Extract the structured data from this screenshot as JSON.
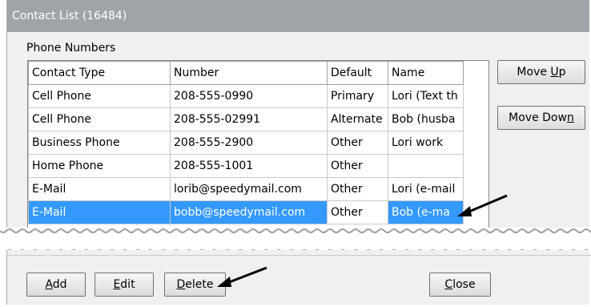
{
  "window": {
    "title": "Contact List (16484)"
  },
  "phone_numbers": {
    "group_label": "Phone Numbers",
    "columns": [
      "Contact Type",
      "Number",
      "Default",
      "Name"
    ],
    "rows": [
      [
        "Cell Phone",
        "208-555-0990",
        "Primary",
        "Lori (Text th"
      ],
      [
        "Cell Phone",
        "208-555-02991",
        "Alternate",
        "Bob (husba"
      ],
      [
        "Business Phone",
        "208-555-2900",
        "Other",
        "Lori work"
      ],
      [
        "Home Phone",
        "208-555-1001",
        "Other",
        ""
      ],
      [
        "E-Mail",
        "lorib@speedymail.com",
        "Other",
        "Lori (e-mail"
      ],
      [
        "E-Mail",
        "bobb@speedymail.com",
        "Other",
        "Bob (e-ma"
      ]
    ],
    "selected_row_index": 5
  },
  "buttons": {
    "move_up": {
      "pre": "Move ",
      "key": "U",
      "post": "p"
    },
    "move_down": {
      "pre": "Move Dow",
      "key": "n",
      "post": ""
    },
    "add": {
      "pre": "",
      "key": "A",
      "post": "dd"
    },
    "edit": {
      "pre": "",
      "key": "E",
      "post": "dit"
    },
    "delete": {
      "pre": "",
      "key": "D",
      "post": "elete"
    },
    "close": {
      "pre": "",
      "key": "C",
      "post": "lose"
    }
  },
  "colors": {
    "titlebar": "#9fa4a9",
    "selection": "#3399ff",
    "window_bg": "#f0f0f0"
  }
}
